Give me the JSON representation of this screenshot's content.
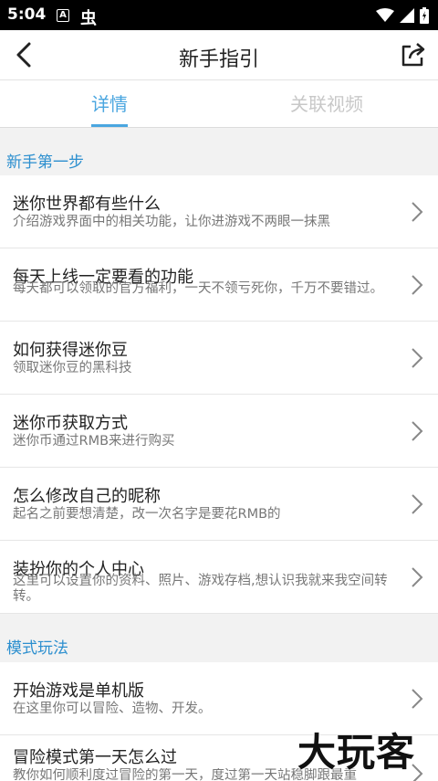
{
  "status": {
    "time": "5:04",
    "notif_a": "A",
    "notif_bug": "虫"
  },
  "header": {
    "title": "新手指引"
  },
  "tabs": [
    {
      "label": "详情"
    },
    {
      "label": "关联视频"
    }
  ],
  "sections": [
    {
      "title": "新手第一步",
      "items": [
        {
          "title": "迷你世界都有些什么",
          "desc": "介绍游戏界面中的相关功能，让你进游戏不两眼一抹黑"
        },
        {
          "title": "每天上线一定要看的功能",
          "desc": "每天都可以领取的官方福利，一天不领亏死你，千万不要错过。"
        },
        {
          "title": "如何获得迷你豆",
          "desc": "领取迷你豆的黑科技"
        },
        {
          "title": "迷你币获取方式",
          "desc": "迷你币通过RMB来进行购买"
        },
        {
          "title": "怎么修改自己的昵称",
          "desc": "起名之前要想清楚，改一次名字是要花RMB的"
        },
        {
          "title": "装扮你的个人中心",
          "desc": "这里可以设置你的资料、照片、游戏存档,想认识我就来我空间转转。"
        }
      ]
    },
    {
      "title": "模式玩法",
      "items": [
        {
          "title": "开始游戏是单机版",
          "desc": "在这里你可以冒险、造物、开发。"
        },
        {
          "title": "冒险模式第一天怎么过",
          "desc": "教你如何顺利度过冒险的第一天，度过第一天站稳脚跟最重"
        }
      ]
    }
  ],
  "watermark": "大玩客"
}
